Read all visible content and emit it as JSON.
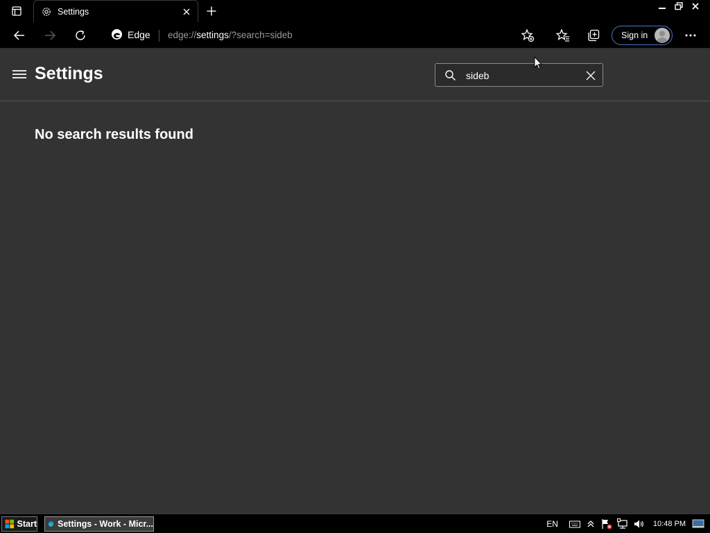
{
  "tab": {
    "title": "Settings"
  },
  "toolbar": {
    "edge_label": "Edge",
    "address_prefix": "edge://",
    "address_host": "settings",
    "address_rest": "/?search=sideb",
    "signin_label": "Sign in"
  },
  "page": {
    "title": "Settings",
    "search_value": "sideb",
    "no_results": "No search results found"
  },
  "taskbar": {
    "start_label": "Start",
    "task_label": "Settings - Work - Micr...",
    "language": "EN",
    "clock": "10:48 PM"
  },
  "colors": {
    "page_bg": "#333333",
    "chrome_bg": "#000000",
    "signin_border": "#4a78c4",
    "spell_error": "#d13438"
  }
}
